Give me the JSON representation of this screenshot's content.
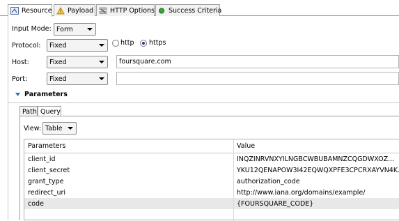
{
  "tabs": [
    {
      "label": "Resource",
      "icon": "resource-icon"
    },
    {
      "label": "Payload",
      "icon": "payload-icon"
    },
    {
      "label": "HTTP Options",
      "icon": "http-options-icon"
    },
    {
      "label": "Success Criteria",
      "icon": "success-criteria-icon"
    }
  ],
  "form": {
    "input_mode_label": "Input Mode:",
    "input_mode_value": "Form",
    "protocol_label": "Protocol:",
    "protocol_mode": "Fixed",
    "protocol_options": [
      {
        "label": "http",
        "selected": false
      },
      {
        "label": "https",
        "selected": true
      }
    ],
    "host_label": "Host:",
    "host_mode": "Fixed",
    "host_value": "foursquare.com",
    "port_label": "Port:",
    "port_mode": "Fixed",
    "port_value": ""
  },
  "parameters": {
    "section_title": "Parameters",
    "tabs": [
      "Path",
      "Query"
    ],
    "active_tab": "Query",
    "view_label": "View:",
    "view_value": "Table",
    "columns": [
      "Parameters",
      "Value"
    ],
    "rows": [
      {
        "name": "client_id",
        "value": "INQZINRVNXYILNGBCWBUBAMNZCQGDWXOZ..."
      },
      {
        "name": "client_secret",
        "value": "YKU12QENAPOW3I42EQWQXPFE3CPCRXAYVN4K..."
      },
      {
        "name": "grant_type",
        "value": "authorization_code"
      },
      {
        "name": "redirect_uri",
        "value": "http://www.iana.org/domains/example/"
      },
      {
        "name": "code",
        "value": "{FOURSQUARE_CODE}",
        "selected": true
      }
    ]
  },
  "colors": {
    "tab_border": "#a0a0a0",
    "selected_row": "#e8e8e8",
    "section_arrow": "#3a6ea5"
  }
}
